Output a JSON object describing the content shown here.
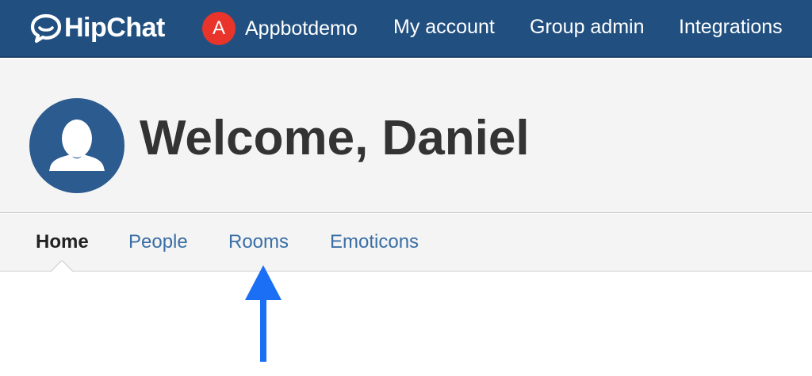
{
  "header": {
    "logo_text": "HipChat",
    "group_initial": "A",
    "group_name": "Appbotdemo",
    "nav": {
      "my_account": "My account",
      "group_admin": "Group admin",
      "integrations": "Integrations"
    }
  },
  "hero": {
    "welcome": "Welcome, Daniel"
  },
  "tabs": {
    "items": [
      {
        "label": "Home",
        "active": true
      },
      {
        "label": "People",
        "active": false
      },
      {
        "label": "Rooms",
        "active": false
      },
      {
        "label": "Emoticons",
        "active": false
      }
    ]
  },
  "colors": {
    "header_bg": "#215080",
    "group_badge": "#e8342a",
    "avatar_bg": "#2c5b8f",
    "link": "#3a6ea5",
    "arrow": "#1a6ff5"
  },
  "icons": {
    "logo": "hipchat-bubble-icon",
    "avatar": "user-silhouette-icon",
    "annotation": "arrow-up-icon"
  }
}
